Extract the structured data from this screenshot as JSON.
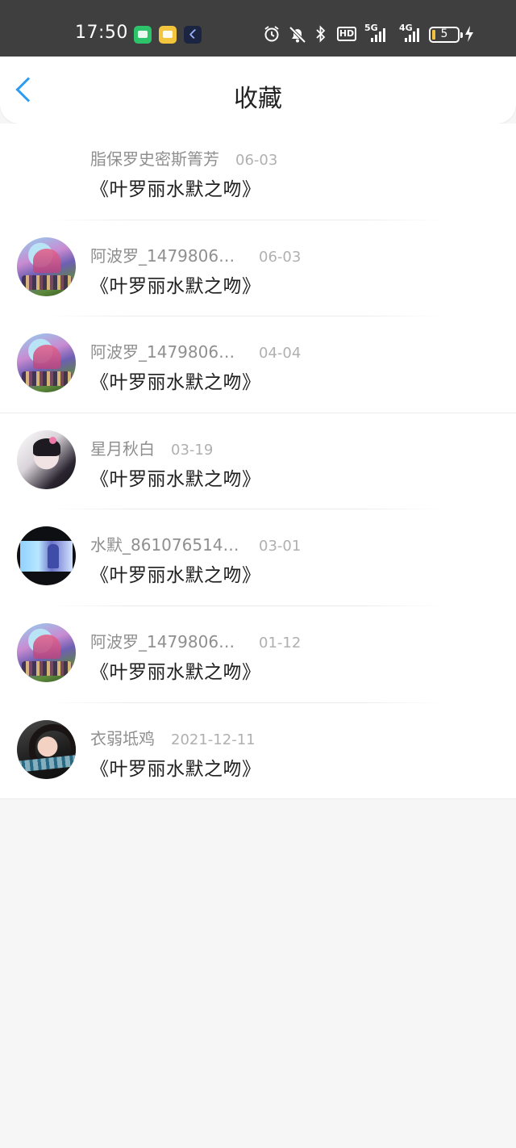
{
  "status_bar": {
    "time": "17:50",
    "network": "5G",
    "network2": "4G",
    "hd_label": "HD",
    "battery": "5"
  },
  "header": {
    "title": "收藏"
  },
  "favorites": [
    {
      "name": "脂保罗史密斯箐芳",
      "date": "06-03",
      "work": "《叶罗丽水默之吻》",
      "avatar": "none"
    },
    {
      "name": "阿波罗_14798063...",
      "date": "06-03",
      "work": "《叶罗丽水默之吻》",
      "avatar": "apollo"
    },
    {
      "name": "阿波罗_14798063...",
      "date": "04-04",
      "work": "《叶罗丽水默之吻》",
      "avatar": "apollo"
    },
    {
      "name": "星月秋白",
      "date": "03-19",
      "work": "《叶罗丽水默之吻》",
      "avatar": "anime-girl"
    },
    {
      "name": "水默_8610765144...",
      "date": "03-01",
      "work": "《叶罗丽水默之吻》",
      "avatar": "water-scene"
    },
    {
      "name": "阿波罗_14798063...",
      "date": "01-12",
      "work": "《叶罗丽水默之吻》",
      "avatar": "apollo"
    },
    {
      "name": "衣弱坻鸡",
      "date": "2021-12-11",
      "work": "《叶罗丽水默之吻》",
      "avatar": "portrait"
    }
  ]
}
